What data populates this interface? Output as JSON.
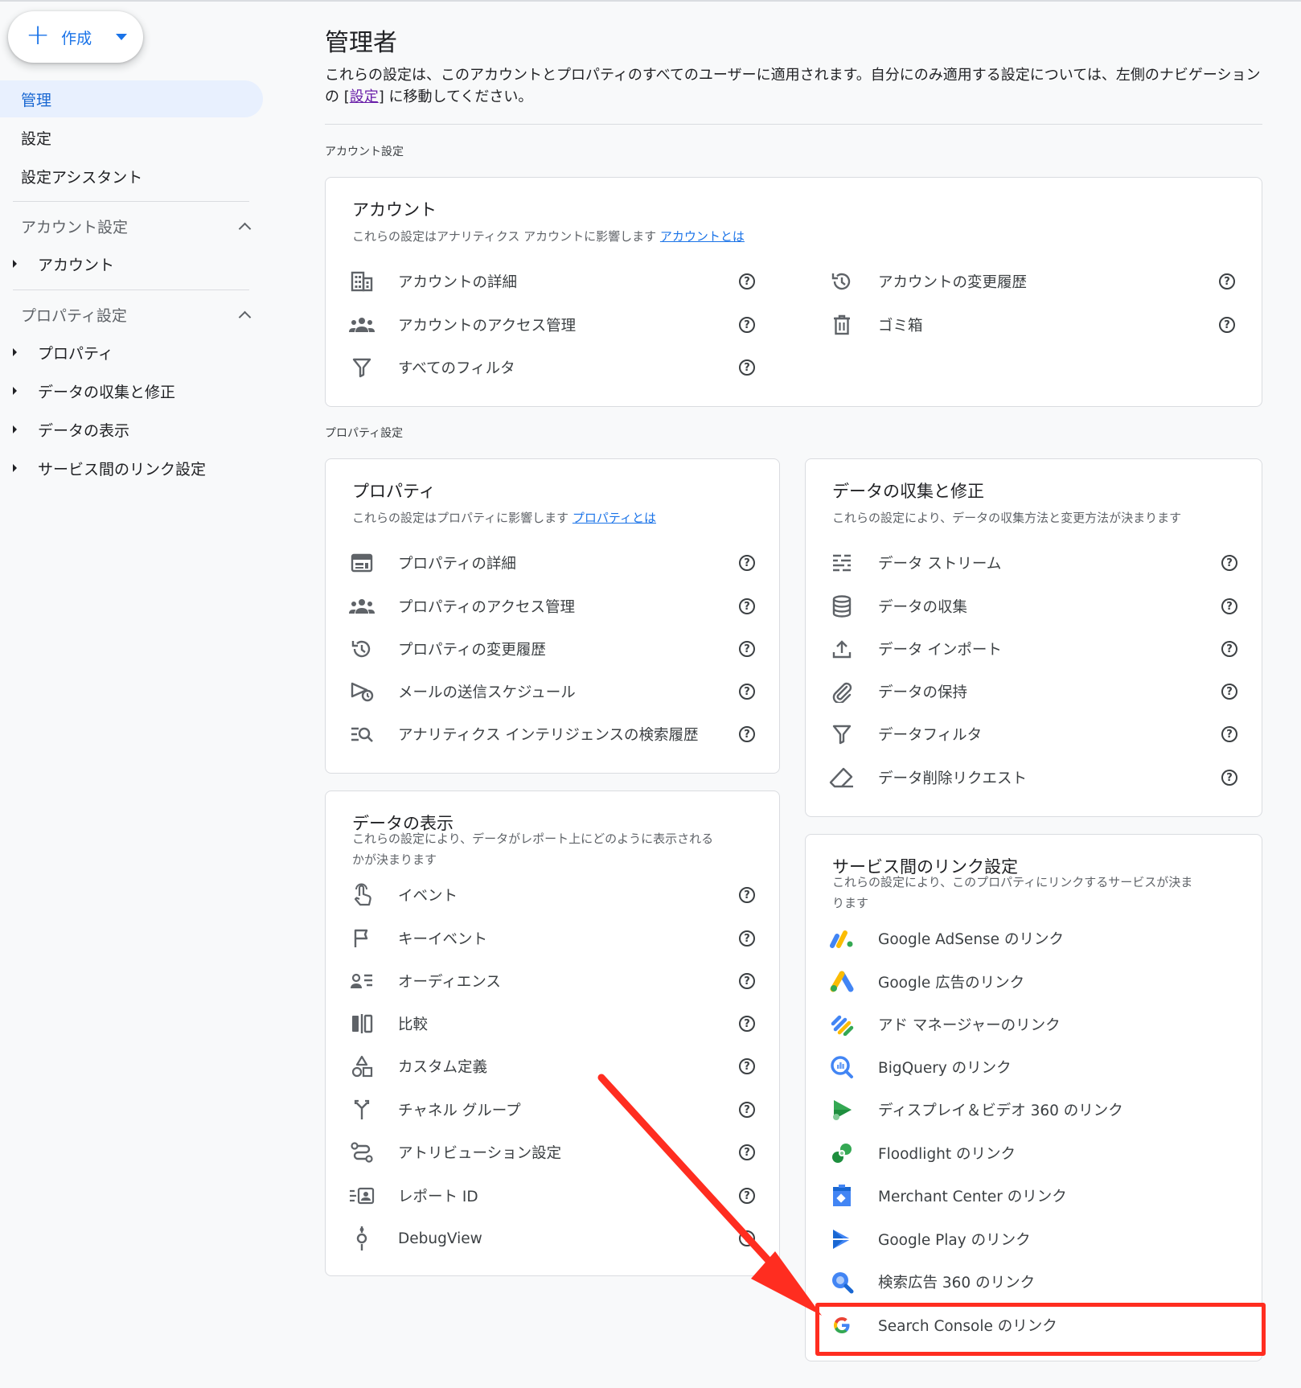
{
  "create_button": {
    "label": "作成"
  },
  "nav": {
    "admin": "管理",
    "settings": "設定",
    "setup_assistant": "設定アシスタント",
    "account_section": "アカウント設定",
    "account": "アカウント",
    "property_section": "プロパティ設定",
    "property": "プロパティ",
    "data_collection": "データの収集と修正",
    "data_display": "データの表示",
    "product_links": "サービス間のリンク設定"
  },
  "page": {
    "title": "管理者",
    "desc_part1": "これらの設定は、このアカウントとプロパティのすべてのユーザーに適用されます。自分にのみ適用する設定については、左側のナビゲーションの [",
    "desc_link": "設定",
    "desc_part2": "] に移動してください。",
    "account_settings_label": "アカウント設定",
    "property_settings_label": "プロパティ設定"
  },
  "account_card": {
    "title": "アカウント",
    "subtitle": "これらの設定はアナリティクス アカウントに影響します",
    "subtitle_link": "アカウントとは",
    "left_items": [
      "アカウントの詳細",
      "アカウントのアクセス管理",
      "すべてのフィルタ"
    ],
    "right_items": [
      "アカウントの変更履歴",
      "ゴミ箱"
    ]
  },
  "property_card": {
    "title": "プロパティ",
    "subtitle": "これらの設定はプロパティに影響します",
    "subtitle_link": "プロパティとは",
    "items": [
      "プロパティの詳細",
      "プロパティのアクセス管理",
      "プロパティの変更履歴",
      "メールの送信スケジュール",
      "アナリティクス インテリジェンスの検索履歴"
    ]
  },
  "data_collection_card": {
    "title": "データの収集と修正",
    "subtitle": "これらの設定により、データの収集方法と変更方法が決まります",
    "items": [
      "データ ストリーム",
      "データの収集",
      "データ インポート",
      "データの保持",
      "データフィルタ",
      "データ削除リクエスト"
    ]
  },
  "data_display_card": {
    "title": "データの表示",
    "subtitle_line1": "これらの設定により、データがレポート上にどのように表示される",
    "subtitle_line2": "かが決まります",
    "items": [
      "イベント",
      "キーイベント",
      "オーディエンス",
      "比較",
      "カスタム定義",
      "チャネル グループ",
      "アトリビューション設定",
      "レポート ID",
      "DebugView"
    ]
  },
  "product_links_card": {
    "title": "サービス間のリンク設定",
    "subtitle_line1": "これらの設定により、このプロパティにリンクするサービスが決ま",
    "subtitle_line2": "ります",
    "items": [
      "Google AdSense のリンク",
      "Google 広告のリンク",
      "アド マネージャーのリンク",
      "BigQuery のリンク",
      "ディスプレイ＆ビデオ 360 のリンク",
      "Floodlight のリンク",
      "Merchant Center のリンク",
      "Google Play のリンク",
      "検索広告 360 のリンク",
      "Search Console のリンク"
    ]
  },
  "help_glyph": "?",
  "colors": {
    "accent": "#1a73e8",
    "active_bg": "#e8f0fe",
    "annotation": "#ff2d20"
  }
}
